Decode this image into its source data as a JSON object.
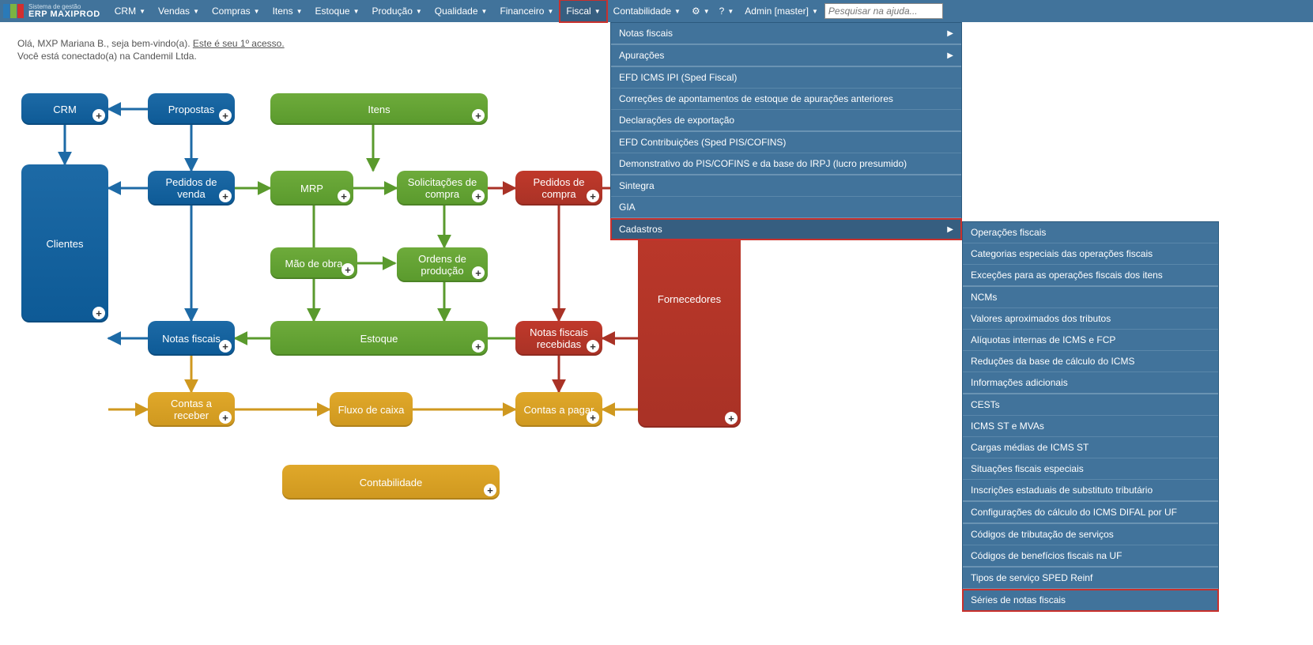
{
  "brand": {
    "tagline": "Sistema de gestão",
    "name": "ERP MAXIPROD"
  },
  "topmenu": {
    "crm": "CRM",
    "vendas": "Vendas",
    "compras": "Compras",
    "itens": "Itens",
    "estoque": "Estoque",
    "producao": "Produção",
    "qualidade": "Qualidade",
    "financeiro": "Financeiro",
    "fiscal": "Fiscal",
    "contabilidade": "Contabilidade",
    "admin": "Admin [master]"
  },
  "search": {
    "placeholder": "Pesquisar na ajuda..."
  },
  "welcome": {
    "greeting": "Olá, MXP Mariana B., seja bem-vindo(a). ",
    "first_access": "Este é seu 1º acesso.",
    "connected": "Você está conectado(a) na Candemil Ltda."
  },
  "nodes": {
    "crm": "CRM",
    "propostas": "Propostas",
    "clientes": "Clientes",
    "pedidos_venda": "Pedidos de venda",
    "itens": "Itens",
    "mrp": "MRP",
    "solicitacoes": "Solicitações de compra",
    "pedidos_compra": "Pedidos de compra",
    "mao_de_obra": "Mão de obra",
    "ordens_producao": "Ordens de produção",
    "notas_fiscais": "Notas fiscais",
    "estoque": "Estoque",
    "nf_recebidas": "Notas fiscais recebidas",
    "fornecedores": "Fornecedores",
    "contas_receber": "Contas a receber",
    "fluxo_caixa": "Fluxo de caixa",
    "contas_pagar": "Contas a pagar",
    "contabilidade": "Contabilidade"
  },
  "dropdown": {
    "notas_fiscais": "Notas fiscais",
    "apuracoes": "Apurações",
    "efd_icms": "EFD ICMS IPI (Sped Fiscal)",
    "correcoes": "Correções de apontamentos de estoque de apurações anteriores",
    "declaracoes": "Declarações de exportação",
    "efd_contrib": "EFD Contribuições (Sped PIS/COFINS)",
    "demonstrativo": "Demonstrativo do PIS/COFINS e da base do IRPJ (lucro presumido)",
    "sintegra": "Sintegra",
    "gia": "GIA",
    "cadastros": "Cadastros"
  },
  "submenu": {
    "operacoes": "Operações fiscais",
    "categorias": "Categorias especiais das operações fiscais",
    "excecoes": "Exceções para as operações fiscais dos itens",
    "ncms": "NCMs",
    "valores_aprox": "Valores aproximados dos tributos",
    "aliquotas": "Alíquotas internas de ICMS e FCP",
    "reducoes": "Reduções da base de cálculo do ICMS",
    "info_adicionais": "Informações adicionais",
    "cests": "CESTs",
    "icms_st_mvas": "ICMS ST e MVAs",
    "cargas": "Cargas médias de ICMS ST",
    "situacoes": "Situações fiscais especiais",
    "inscricoes": "Inscrições estaduais de substituto tributário",
    "config_difal": "Configurações do cálculo do ICMS DIFAL por UF",
    "codigos_trib": "Códigos de tributação de serviços",
    "codigos_benef": "Códigos de benefícios fiscais na UF",
    "tipos_sped": "Tipos de serviço SPED Reinf",
    "series_nf": "Séries de notas fiscais"
  }
}
